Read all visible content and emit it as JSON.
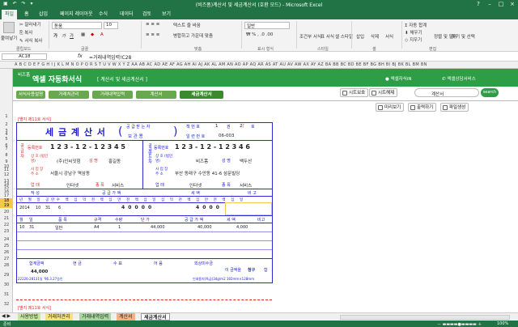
{
  "window": {
    "title": "(비즈폼)계산서 및 세금계산서 (호환 모드) - Microsoft Excel"
  },
  "ribbon_tabs": [
    "파일",
    "홈",
    "삽입",
    "페이지 레이아웃",
    "수식",
    "데이터",
    "검토",
    "보기"
  ],
  "ribbon": {
    "paste": "붙여넣기",
    "cut": "잘라내기",
    "copy": "복사",
    "format_painter": "서식 복사",
    "clipboard": "클립보드",
    "font_name": "돋움",
    "font_size": "10",
    "bold": "가",
    "italic": "가",
    "underline": "가",
    "font_group": "글꼴",
    "wrap": "텍스트 줄 바꿈",
    "merge": "병합하고 가운데 맞춤",
    "align_group": "맞춤",
    "number_format": "일반",
    "number_group": "표시 형식",
    "cond_format": "조건부 서식",
    "table_format": "표 서식",
    "cell_style": "셀 스타일",
    "style_group": "스타일",
    "insert": "삽입",
    "delete": "삭제",
    "format": "서식",
    "cells_group": "셀",
    "autosum": "자동 합계",
    "fill": "채우기",
    "clear": "지우기",
    "sort": "정렬 및 필터",
    "find": "찾기 및 선택",
    "edit_group": "편집"
  },
  "formula": {
    "namebox": "AC18",
    "fx": "fx",
    "value": "=거래내역입력!C28"
  },
  "columns": "A B C D E F G H I J K L M N O P Q R S T U V W X Y Z AA AB AC AD AE AF AG AH AI AJ AK AL AM AN AO AP AQ AR AS AT AU AV AW AX AY AZ BA BB BC BD BE BF BG BH BI BJ BK BL BM BN",
  "rows": [
    "1",
    "2",
    "3",
    "4",
    "5",
    "6",
    "7",
    "8",
    "9",
    "10",
    "11",
    "12",
    "13",
    "14",
    "15",
    "16",
    "17",
    "18",
    "19",
    "20",
    "21",
    "22",
    "23",
    "24",
    "25",
    "26",
    "27",
    "28",
    "29",
    "30",
    "31",
    "32",
    "33",
    "34"
  ],
  "header": {
    "brand": "비즈폼",
    "app_title": "엑셀 자동화서식",
    "subtitle": "[ 계산서 및 세금계산서 ]",
    "link1": "엑셀자식iN",
    "link2": "엑셀상담서비스"
  },
  "nav": {
    "tabs": [
      "서식사용설명",
      "거래처관리",
      "거래내역입력",
      "계산서",
      "세금계산서"
    ]
  },
  "toolbar": {
    "protect": "시트보호",
    "unprotect": "시트해제",
    "search_placeholder": "계산서",
    "search_btn": "search",
    "preview": "미리보기",
    "print": "출력하기",
    "save": "파일생성"
  },
  "invoice": {
    "form_no": "[별지 제11호 서식]",
    "title": "세 금 계 산 서",
    "supplier_label": "공 급 받 는 자",
    "keep_label": "보 관 용",
    "book_no": "책 번 호",
    "vol": "1",
    "vol_unit": "권",
    "page": "2",
    "page_unit": "호",
    "serial": "일 련 번 호",
    "serial_val": "06-003",
    "supplier": {
      "side": "공 급 자",
      "reg_label": "등록번호",
      "reg": "1 2 3 - 1 2 - 1 2 3 4 5",
      "company_label": "상 호 (법인명)",
      "company": "(주)인씨잇험",
      "name_label": "성 명",
      "name": "홍길동",
      "addr_label": "사 업 장 주 소",
      "addr": "서울시 강남구 역삼동",
      "type_label": "업 태",
      "type": "인터넷",
      "item_label": "종 목",
      "item": "서비스"
    },
    "buyer": {
      "side": "공급받는자",
      "reg_label": "등록번호",
      "reg": "1 2 3 - 1 2 - 1 2 3 4 6",
      "company_label": "상 호 (법인명)",
      "company": "비즈폼",
      "name_label": "성 명",
      "name": "백두산",
      "addr_label": "사 업 장 주 소",
      "addr": "부산 동래구 수안동 41-6 삼문빌딩",
      "type_label": "업 태",
      "type": "인터넷",
      "item_label": "종 목",
      "item": "서비스"
    },
    "write_label": "작 성",
    "supply_label": "공 급 가 액",
    "tax_label": "세 액",
    "note_label": "비 고",
    "sub_cols": [
      "년",
      "월",
      "일",
      "공란수",
      "백",
      "십",
      "억",
      "천",
      "백",
      "십",
      "만",
      "천",
      "백",
      "십",
      "일",
      "십",
      "억",
      "천",
      "백",
      "십",
      "만",
      "천",
      "백",
      "십",
      "일"
    ],
    "date": {
      "y": "2014",
      "m": "10",
      "d": "31",
      "blank": "6"
    },
    "supply_digits": "4 0 0 0 0",
    "tax_digits": "4 0 0 0",
    "item_head": [
      "월",
      "일",
      "품 목",
      "규격",
      "수량",
      "단 가",
      "공 급 가 액",
      "세 액",
      "비고"
    ],
    "items": [
      {
        "m": "10",
        "d": "31",
        "name": "일반",
        "spec": "A4",
        "qty": "1",
        "price": "44,000",
        "supply": "40,000",
        "tax": "4,000"
      }
    ],
    "total_label": "합계금액",
    "cash": "현 금",
    "check": "수 표",
    "note": "어 음",
    "credit": "외상미수금",
    "total": "44,000",
    "receipt": "이 금액을",
    "claim": "청구",
    "claim_suffix": "함",
    "footer_left": "22226-28131일 '96.3.27승인",
    "footer_right": "인쇄용지(특급)34g/m2 182mm×128mm",
    "form_no2": "[별지 제11호 서식]"
  },
  "sheets": [
    "사용방법",
    "거래처관리",
    "거래내역입력",
    "계산서",
    "세금계산서"
  ],
  "status": {
    "ready": "준비",
    "zoom": "100%"
  }
}
